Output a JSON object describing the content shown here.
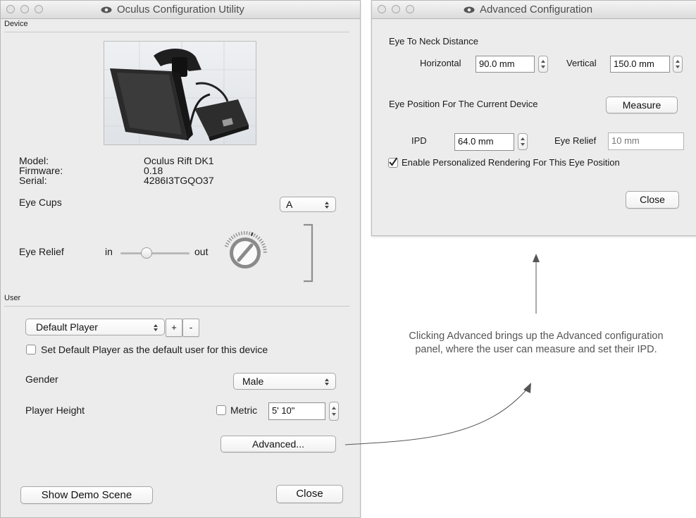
{
  "main_window": {
    "title": "Oculus Configuration Utility",
    "device_section": {
      "label": "Device",
      "model_label": "Model:",
      "model_value": "Oculus Rift DK1",
      "firmware_label": "Firmware:",
      "firmware_value": "0.18",
      "serial_label": "Serial:",
      "serial_value": "4286I3TGQO37",
      "eye_cups_label": "Eye Cups",
      "eye_cups_value": "A",
      "eye_relief_label": "Eye Relief",
      "slider_in": "in",
      "slider_out": "out",
      "slider_position": 0.35
    },
    "user_section": {
      "label": "User",
      "player_select": "Default Player",
      "add_label": "+",
      "remove_label": "-",
      "default_checkbox_label": "Set Default Player as the default user for this device",
      "default_checked": false,
      "gender_label": "Gender",
      "gender_value": "Male",
      "height_label": "Player Height",
      "metric_label": "Metric",
      "metric_checked": false,
      "height_value": "5' 10\"",
      "advanced_button": "Advanced..."
    },
    "footer": {
      "demo_button": "Show Demo Scene",
      "close_button": "Close"
    }
  },
  "advanced_window": {
    "title": "Advanced Configuration",
    "eye_to_neck_label": "Eye To Neck Distance",
    "horizontal_label": "Horizontal",
    "horizontal_value": "90.0 mm",
    "vertical_label": "Vertical",
    "vertical_value": "150.0 mm",
    "eye_position_label": "Eye Position For The Current Device",
    "measure_button": "Measure",
    "ipd_label": "IPD",
    "ipd_value": "64.0 mm",
    "eye_relief_label": "Eye Relief",
    "eye_relief_value": "10 mm",
    "personalized_label": "Enable Personalized Rendering For This Eye Position",
    "personalized_checked": true,
    "close_button": "Close"
  },
  "annotation": {
    "text": "Clicking Advanced brings up the Advanced configuration panel, where the user can measure and set their IPD."
  },
  "colors": {
    "window_bg": "#ececec",
    "annotation_text": "#555555",
    "arrow": "#555555"
  }
}
